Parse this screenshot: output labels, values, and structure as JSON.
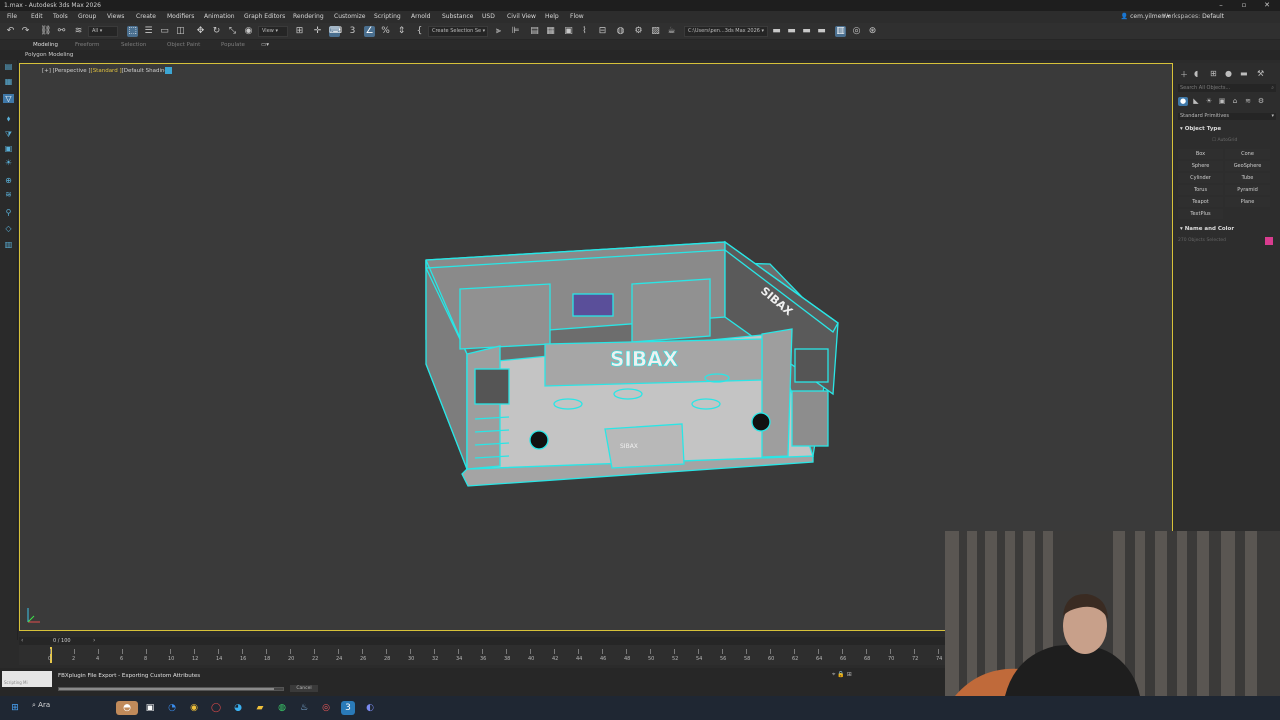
{
  "window": {
    "title": "1.max - Autodesk 3ds Max 2026"
  },
  "menu": {
    "items": [
      "File",
      "Edit",
      "Tools",
      "Group",
      "Views",
      "Create",
      "Modifiers",
      "Animation",
      "Graph Editors",
      "Rendering",
      "Customize",
      "Scripting",
      "Arnold",
      "Substance",
      "USD",
      "Civil View",
      "Help",
      "Flow"
    ],
    "user": "cem.yilmen",
    "workspace_label": "Workspaces:",
    "workspace_value": "Default"
  },
  "toolbar": {
    "selection_filter": "All",
    "ref_coord": "View",
    "selection_set": "Create Selection Se",
    "project_path": "C:\\Users\\pen...3ds Max 2026"
  },
  "ribbon": {
    "tabs": [
      "Modeling",
      "Freeform",
      "Selection",
      "Object Paint",
      "Populate"
    ],
    "active_tab": "Modeling",
    "subpanel": "Polygon Modeling"
  },
  "viewport": {
    "label_prefix": "[+] [Perspective ]",
    "label_mode": "[Standard ]",
    "label_shading": "[Default Shading ]",
    "model_brand": "SIBAX"
  },
  "command_panel": {
    "search_placeholder": "Search All Objects...",
    "category": "Standard Primitives",
    "object_type_title": "Object Type",
    "autogrid": "AutoGrid",
    "buttons": [
      "Box",
      "Cone",
      "Sphere",
      "GeoSphere",
      "Cylinder",
      "Tube",
      "Torus",
      "Pyramid",
      "Teapot",
      "Plane",
      "TextPlus"
    ],
    "name_color_title": "Name and Color",
    "name_value": "270 Objects Selected",
    "swatch_color": "#d93c8f"
  },
  "timeline": {
    "frame_label": "0 / 100",
    "ticks": [
      "0",
      "2",
      "4",
      "6",
      "8",
      "10",
      "12",
      "14",
      "16",
      "18",
      "20",
      "22",
      "24",
      "26",
      "28",
      "30",
      "32",
      "34",
      "36",
      "38",
      "40",
      "42",
      "44",
      "46",
      "48",
      "50",
      "52",
      "54",
      "56",
      "58",
      "60",
      "62",
      "64",
      "66",
      "68",
      "70",
      "72",
      "74"
    ]
  },
  "status": {
    "maxscript_label": "Scripting Mi",
    "message": "FBXplugin File Export  -  Exporting Custom Attributes",
    "cancel_label": "Cancel",
    "progress": 0.96
  },
  "taskbar": {
    "search_label": "Ara"
  },
  "colors": {
    "wire": "#29e6e6",
    "viewport_border": "#d7c23a",
    "accent": "#3f78a8"
  }
}
